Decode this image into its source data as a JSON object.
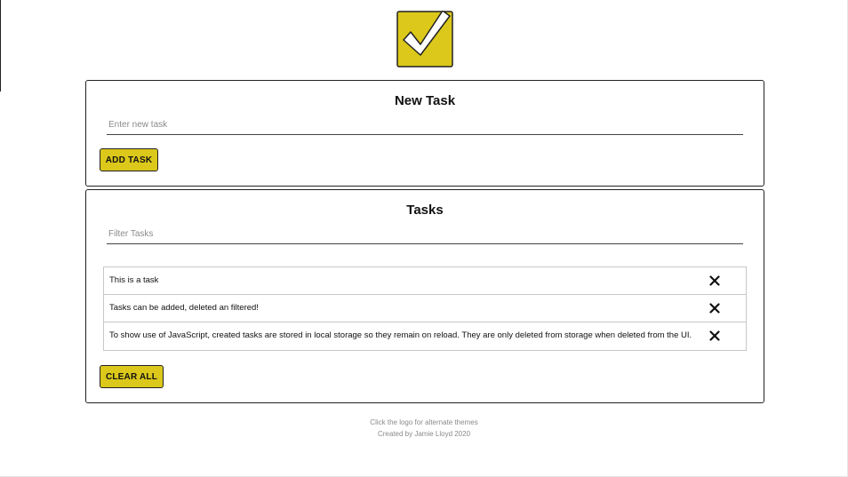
{
  "logo": {
    "icon": "checkmark-logo-icon",
    "color": "#dcc81a"
  },
  "new_task": {
    "title": "New Task",
    "input_placeholder": "Enter new task",
    "input_value": "",
    "add_button_label": "ADD TASK"
  },
  "tasks": {
    "title": "Tasks",
    "filter_placeholder": "Filter Tasks",
    "filter_value": "",
    "items": [
      {
        "text": "This is a task",
        "delete_icon": "close-icon"
      },
      {
        "text": "Tasks can be added, deleted an filtered!",
        "delete_icon": "close-icon"
      },
      {
        "text": "To show use of JavaScript, created tasks are stored in local storage so they remain on reload. They are only deleted from storage when deleted from the UI.",
        "delete_icon": "close-icon"
      }
    ],
    "clear_button_label": "CLEAR ALL"
  },
  "footer": {
    "line1": "Click the logo for alternate themes",
    "line2": "Created by Jamie Lloyd 2020"
  },
  "colors": {
    "accent": "#dcc81a",
    "border": "#222222",
    "muted_text": "#8a8a8a"
  }
}
